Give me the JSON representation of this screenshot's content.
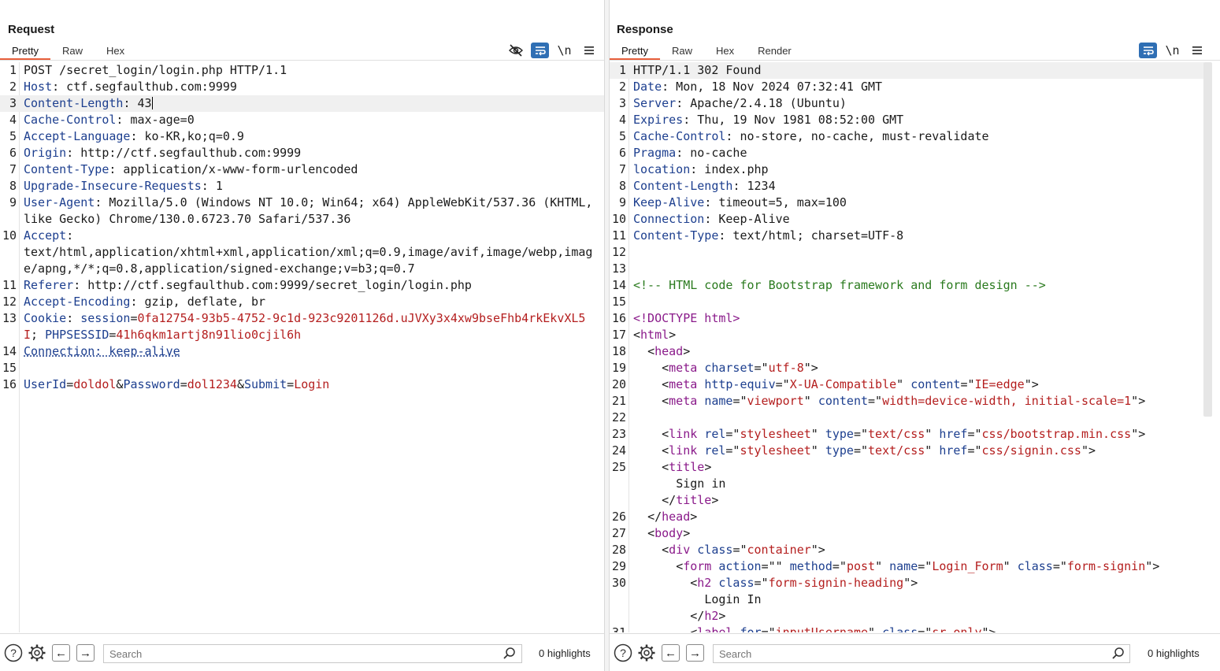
{
  "layout_switch": {
    "selected": "side-by-side"
  },
  "request": {
    "title": "Request",
    "tabs": [
      "Pretty",
      "Raw",
      "Hex"
    ],
    "active_tab": "Pretty",
    "search_placeholder": "Search",
    "highlights": "0 highlights",
    "lines": [
      {
        "n": "1",
        "parts": [
          {
            "t": "POST /secret_login/login.php HTTP/1.1",
            "c": ""
          }
        ]
      },
      {
        "n": "2",
        "parts": [
          {
            "t": "Host",
            "c": "h-name"
          },
          {
            "t": ": ctf.segfaulthub.com:9999",
            "c": ""
          }
        ]
      },
      {
        "n": "3",
        "hl": true,
        "caret": true,
        "parts": [
          {
            "t": "Content-Length",
            "c": "h-name"
          },
          {
            "t": ": 43",
            "c": ""
          }
        ]
      },
      {
        "n": "4",
        "parts": [
          {
            "t": "Cache-Control",
            "c": "h-name"
          },
          {
            "t": ": max-age=0",
            "c": ""
          }
        ]
      },
      {
        "n": "5",
        "parts": [
          {
            "t": "Accept-Language",
            "c": "h-name"
          },
          {
            "t": ": ko-KR,ko;q=0.9",
            "c": ""
          }
        ]
      },
      {
        "n": "6",
        "parts": [
          {
            "t": "Origin",
            "c": "h-name"
          },
          {
            "t": ": http://ctf.segfaulthub.com:9999",
            "c": ""
          }
        ]
      },
      {
        "n": "7",
        "parts": [
          {
            "t": "Content-Type",
            "c": "h-name"
          },
          {
            "t": ": application/x-www-form-urlencoded",
            "c": ""
          }
        ]
      },
      {
        "n": "8",
        "parts": [
          {
            "t": "Upgrade-Insecure-Requests",
            "c": "h-name"
          },
          {
            "t": ": 1",
            "c": ""
          }
        ]
      },
      {
        "n": "9",
        "parts": [
          {
            "t": "User-Agent",
            "c": "h-name"
          },
          {
            "t": ": Mozilla/5.0 (Windows NT 10.0; Win64; x64) AppleWebKit/537.36 (KHTML, like Gecko) Chrome/130.0.6723.70 Safari/537.36",
            "c": ""
          }
        ]
      },
      {
        "n": "10",
        "parts": [
          {
            "t": "Accept",
            "c": "h-name"
          },
          {
            "t": ":\ntext/html,application/xhtml+xml,application/xml;q=0.9,image/avif,image/webp,image/apng,*/*;q=0.8,application/signed-exchange;v=b3;q=0.7",
            "c": ""
          }
        ]
      },
      {
        "n": "11",
        "parts": [
          {
            "t": "Referer",
            "c": "h-name"
          },
          {
            "t": ": http://ctf.segfaulthub.com:9999/secret_login/login.php",
            "c": ""
          }
        ]
      },
      {
        "n": "12",
        "parts": [
          {
            "t": "Accept-Encoding",
            "c": "h-name"
          },
          {
            "t": ": gzip, deflate, br",
            "c": ""
          }
        ]
      },
      {
        "n": "13",
        "parts": [
          {
            "t": "Cookie",
            "c": "h-name"
          },
          {
            "t": ": ",
            "c": ""
          },
          {
            "t": "session",
            "c": "h-name"
          },
          {
            "t": "=",
            "c": ""
          },
          {
            "t": "0fa12754-93b5-4752-9c1d-923c9201126d.uJVXy3x4xw9bseFhb4rkEkvXL5I",
            "c": "val-red"
          },
          {
            "t": "; ",
            "c": ""
          },
          {
            "t": "PHPSESSID",
            "c": "h-name"
          },
          {
            "t": "=",
            "c": ""
          },
          {
            "t": "41h6qkm1artj8n91lio0cjil6h",
            "c": "val-red"
          }
        ]
      },
      {
        "n": "14",
        "parts": [
          {
            "t": "Connection: keep-alive",
            "c": "h-name dotted"
          }
        ]
      },
      {
        "n": "15",
        "parts": [
          {
            "t": "",
            "c": ""
          }
        ]
      },
      {
        "n": "16",
        "parts": [
          {
            "t": "UserId",
            "c": "h-name"
          },
          {
            "t": "=",
            "c": ""
          },
          {
            "t": "doldol",
            "c": "val-red"
          },
          {
            "t": "&",
            "c": ""
          },
          {
            "t": "Password",
            "c": "h-name"
          },
          {
            "t": "=",
            "c": ""
          },
          {
            "t": "dol1234",
            "c": "val-red"
          },
          {
            "t": "&",
            "c": ""
          },
          {
            "t": "Submit",
            "c": "h-name"
          },
          {
            "t": "=",
            "c": ""
          },
          {
            "t": "Login",
            "c": "val-red"
          }
        ]
      }
    ]
  },
  "response": {
    "title": "Response",
    "tabs": [
      "Pretty",
      "Raw",
      "Hex",
      "Render"
    ],
    "active_tab": "Pretty",
    "search_placeholder": "Search",
    "highlights": "0 highlights",
    "lines": [
      {
        "n": "1",
        "hl": true,
        "parts": [
          {
            "t": "HTTP/1.1 302 Found",
            "c": ""
          }
        ]
      },
      {
        "n": "2",
        "parts": [
          {
            "t": "Date",
            "c": "h-name"
          },
          {
            "t": ": Mon, 18 Nov 2024 07:32:41 GMT",
            "c": ""
          }
        ]
      },
      {
        "n": "3",
        "parts": [
          {
            "t": "Server",
            "c": "h-name"
          },
          {
            "t": ": Apache/2.4.18 (Ubuntu)",
            "c": ""
          }
        ]
      },
      {
        "n": "4",
        "parts": [
          {
            "t": "Expires",
            "c": "h-name"
          },
          {
            "t": ": Thu, 19 Nov 1981 08:52:00 GMT",
            "c": ""
          }
        ]
      },
      {
        "n": "5",
        "parts": [
          {
            "t": "Cache-Control",
            "c": "h-name"
          },
          {
            "t": ": no-store, no-cache, must-revalidate",
            "c": ""
          }
        ]
      },
      {
        "n": "6",
        "parts": [
          {
            "t": "Pragma",
            "c": "h-name"
          },
          {
            "t": ": no-cache",
            "c": ""
          }
        ]
      },
      {
        "n": "7",
        "parts": [
          {
            "t": "location",
            "c": "h-name"
          },
          {
            "t": ": index.php",
            "c": ""
          }
        ]
      },
      {
        "n": "8",
        "parts": [
          {
            "t": "Content-Length",
            "c": "h-name"
          },
          {
            "t": ": 1234",
            "c": ""
          }
        ]
      },
      {
        "n": "9",
        "parts": [
          {
            "t": "Keep-Alive",
            "c": "h-name"
          },
          {
            "t": ": timeout=5, max=100",
            "c": ""
          }
        ]
      },
      {
        "n": "10",
        "parts": [
          {
            "t": "Connection",
            "c": "h-name"
          },
          {
            "t": ": Keep-Alive",
            "c": ""
          }
        ]
      },
      {
        "n": "11",
        "parts": [
          {
            "t": "Content-Type",
            "c": "h-name"
          },
          {
            "t": ": text/html; charset=UTF-8",
            "c": ""
          }
        ]
      },
      {
        "n": "12",
        "parts": [
          {
            "t": "",
            "c": ""
          }
        ]
      },
      {
        "n": "13",
        "parts": [
          {
            "t": "",
            "c": ""
          }
        ]
      },
      {
        "n": "14",
        "parts": [
          {
            "t": "<!-- HTML code for Bootstrap framework and form design -->",
            "c": "comment"
          }
        ]
      },
      {
        "n": "15",
        "parts": [
          {
            "t": "",
            "c": ""
          }
        ]
      },
      {
        "n": "16",
        "parts": [
          {
            "t": "<!DOCTYPE html>",
            "c": "tag"
          }
        ]
      },
      {
        "n": "17",
        "parts": [
          {
            "t": "<",
            "c": ""
          },
          {
            "t": "html",
            "c": "tag"
          },
          {
            "t": ">",
            "c": ""
          }
        ]
      },
      {
        "n": "18",
        "parts": [
          {
            "t": "  <",
            "c": ""
          },
          {
            "t": "head",
            "c": "tag"
          },
          {
            "t": ">",
            "c": ""
          }
        ]
      },
      {
        "n": "19",
        "parts": [
          {
            "t": "    <",
            "c": ""
          },
          {
            "t": "meta",
            "c": "tag"
          },
          {
            "t": " ",
            "c": ""
          },
          {
            "t": "charset",
            "c": "attr"
          },
          {
            "t": "=\"",
            "c": ""
          },
          {
            "t": "utf-8",
            "c": "attrval"
          },
          {
            "t": "\">",
            "c": ""
          }
        ]
      },
      {
        "n": "20",
        "parts": [
          {
            "t": "    <",
            "c": ""
          },
          {
            "t": "meta",
            "c": "tag"
          },
          {
            "t": " ",
            "c": ""
          },
          {
            "t": "http-equiv",
            "c": "attr"
          },
          {
            "t": "=\"",
            "c": ""
          },
          {
            "t": "X-UA-Compatible",
            "c": "attrval"
          },
          {
            "t": "\" ",
            "c": ""
          },
          {
            "t": "content",
            "c": "attr"
          },
          {
            "t": "=\"",
            "c": ""
          },
          {
            "t": "IE=edge",
            "c": "attrval"
          },
          {
            "t": "\">",
            "c": ""
          }
        ]
      },
      {
        "n": "21",
        "parts": [
          {
            "t": "    <",
            "c": ""
          },
          {
            "t": "meta",
            "c": "tag"
          },
          {
            "t": " ",
            "c": ""
          },
          {
            "t": "name",
            "c": "attr"
          },
          {
            "t": "=\"",
            "c": ""
          },
          {
            "t": "viewport",
            "c": "attrval"
          },
          {
            "t": "\" ",
            "c": ""
          },
          {
            "t": "content",
            "c": "attr"
          },
          {
            "t": "=\"",
            "c": ""
          },
          {
            "t": "width=device-width, initial-scale=1",
            "c": "attrval"
          },
          {
            "t": "\">",
            "c": ""
          }
        ]
      },
      {
        "n": "22",
        "parts": [
          {
            "t": "",
            "c": ""
          }
        ]
      },
      {
        "n": "23",
        "parts": [
          {
            "t": "    <",
            "c": ""
          },
          {
            "t": "link",
            "c": "tag"
          },
          {
            "t": " ",
            "c": ""
          },
          {
            "t": "rel",
            "c": "attr"
          },
          {
            "t": "=\"",
            "c": ""
          },
          {
            "t": "stylesheet",
            "c": "attrval"
          },
          {
            "t": "\" ",
            "c": ""
          },
          {
            "t": "type",
            "c": "attr"
          },
          {
            "t": "=\"",
            "c": ""
          },
          {
            "t": "text/css",
            "c": "attrval"
          },
          {
            "t": "\" ",
            "c": ""
          },
          {
            "t": "href",
            "c": "attr"
          },
          {
            "t": "=\"",
            "c": ""
          },
          {
            "t": "css/bootstrap.min.css",
            "c": "attrval"
          },
          {
            "t": "\">",
            "c": ""
          }
        ]
      },
      {
        "n": "24",
        "parts": [
          {
            "t": "    <",
            "c": ""
          },
          {
            "t": "link",
            "c": "tag"
          },
          {
            "t": " ",
            "c": ""
          },
          {
            "t": "rel",
            "c": "attr"
          },
          {
            "t": "=\"",
            "c": ""
          },
          {
            "t": "stylesheet",
            "c": "attrval"
          },
          {
            "t": "\" ",
            "c": ""
          },
          {
            "t": "type",
            "c": "attr"
          },
          {
            "t": "=\"",
            "c": ""
          },
          {
            "t": "text/css",
            "c": "attrval"
          },
          {
            "t": "\" ",
            "c": ""
          },
          {
            "t": "href",
            "c": "attr"
          },
          {
            "t": "=\"",
            "c": ""
          },
          {
            "t": "css/signin.css",
            "c": "attrval"
          },
          {
            "t": "\">",
            "c": ""
          }
        ]
      },
      {
        "n": "25",
        "parts": [
          {
            "t": "    <",
            "c": ""
          },
          {
            "t": "title",
            "c": "tag"
          },
          {
            "t": ">\n      Sign in\n    </",
            "c": ""
          },
          {
            "t": "title",
            "c": "tag"
          },
          {
            "t": ">",
            "c": ""
          }
        ]
      },
      {
        "n": "26",
        "parts": [
          {
            "t": "  </",
            "c": ""
          },
          {
            "t": "head",
            "c": "tag"
          },
          {
            "t": ">",
            "c": ""
          }
        ]
      },
      {
        "n": "27",
        "parts": [
          {
            "t": "  <",
            "c": ""
          },
          {
            "t": "body",
            "c": "tag"
          },
          {
            "t": ">",
            "c": ""
          }
        ]
      },
      {
        "n": "28",
        "parts": [
          {
            "t": "    <",
            "c": ""
          },
          {
            "t": "div",
            "c": "tag"
          },
          {
            "t": " ",
            "c": ""
          },
          {
            "t": "class",
            "c": "attr"
          },
          {
            "t": "=\"",
            "c": ""
          },
          {
            "t": "container",
            "c": "attrval"
          },
          {
            "t": "\">",
            "c": ""
          }
        ]
      },
      {
        "n": "29",
        "parts": [
          {
            "t": "      <",
            "c": ""
          },
          {
            "t": "form",
            "c": "tag"
          },
          {
            "t": " ",
            "c": ""
          },
          {
            "t": "action",
            "c": "attr"
          },
          {
            "t": "=\"\" ",
            "c": ""
          },
          {
            "t": "method",
            "c": "attr"
          },
          {
            "t": "=\"",
            "c": ""
          },
          {
            "t": "post",
            "c": "attrval"
          },
          {
            "t": "\" ",
            "c": ""
          },
          {
            "t": "name",
            "c": "attr"
          },
          {
            "t": "=\"",
            "c": ""
          },
          {
            "t": "Login_Form",
            "c": "attrval"
          },
          {
            "t": "\" ",
            "c": ""
          },
          {
            "t": "class",
            "c": "attr"
          },
          {
            "t": "=\"",
            "c": ""
          },
          {
            "t": "form-signin",
            "c": "attrval"
          },
          {
            "t": "\">",
            "c": ""
          }
        ]
      },
      {
        "n": "30",
        "parts": [
          {
            "t": "        <",
            "c": ""
          },
          {
            "t": "h2",
            "c": "tag"
          },
          {
            "t": " ",
            "c": ""
          },
          {
            "t": "class",
            "c": "attr"
          },
          {
            "t": "=\"",
            "c": ""
          },
          {
            "t": "form-signin-heading",
            "c": "attrval"
          },
          {
            "t": "\">\n          Login In\n        </",
            "c": ""
          },
          {
            "t": "h2",
            "c": "tag"
          },
          {
            "t": ">",
            "c": ""
          }
        ]
      },
      {
        "n": "31",
        "parts": [
          {
            "t": "        <",
            "c": ""
          },
          {
            "t": "label",
            "c": "tag"
          },
          {
            "t": " ",
            "c": ""
          },
          {
            "t": "for",
            "c": "attr"
          },
          {
            "t": "=\"",
            "c": ""
          },
          {
            "t": "inputUsername",
            "c": "attrval"
          },
          {
            "t": "\" ",
            "c": ""
          },
          {
            "t": "class",
            "c": "attr"
          },
          {
            "t": "=\"",
            "c": ""
          },
          {
            "t": "sr-only",
            "c": "attrval"
          },
          {
            "t": "\">",
            "c": ""
          }
        ]
      }
    ]
  }
}
